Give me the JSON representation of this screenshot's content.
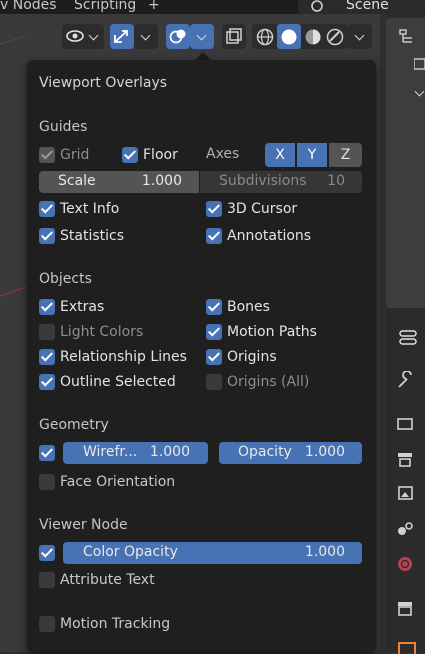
{
  "topbar": {
    "nodes": "v Nodes",
    "scripting": "Scripting",
    "add": "+",
    "scene": "Scene"
  },
  "popup": {
    "title": "Viewport Overlays",
    "guides": {
      "heading": "Guides",
      "grid": "Grid",
      "floor": "Floor",
      "axes": "Axes",
      "x": "X",
      "y": "Y",
      "z": "Z",
      "scale_label": "Scale",
      "scale_value": "1.000",
      "subdivisions_label": "Subdivisions",
      "subdivisions_value": "10",
      "text_info": "Text Info",
      "cursor": "3D Cursor",
      "statistics": "Statistics",
      "annotations": "Annotations"
    },
    "objects": {
      "heading": "Objects",
      "extras": "Extras",
      "bones": "Bones",
      "light_colors": "Light Colors",
      "motion_paths": "Motion Paths",
      "relationship_lines": "Relationship Lines",
      "origins": "Origins",
      "outline_selected": "Outline Selected",
      "origins_all": "Origins (All)"
    },
    "geometry": {
      "heading": "Geometry",
      "wireframe_label": "Wirefr...",
      "wireframe_value": "1.000",
      "opacity_label": "Opacity",
      "opacity_value": "1.000",
      "face_orientation": "Face Orientation"
    },
    "viewer_node": {
      "heading": "Viewer Node",
      "color_opacity_label": "Color Opacity",
      "color_opacity_value": "1.000",
      "attribute_text": "Attribute Text"
    },
    "motion_tracking": "Motion Tracking"
  },
  "colors": {
    "accent": "#4772b3",
    "panel": "#1f1f1f",
    "viewport": "#3a3a3a"
  }
}
